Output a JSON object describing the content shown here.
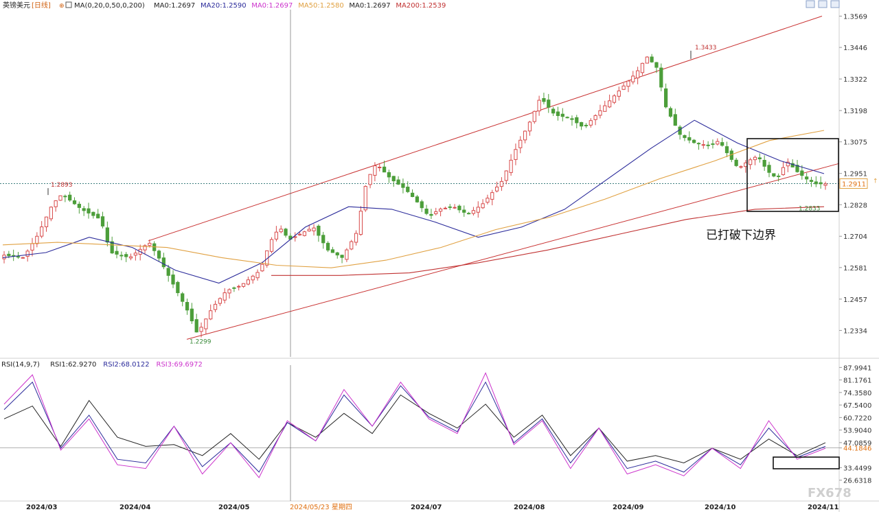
{
  "header": {
    "symbol": "英镑美元",
    "period": "日线",
    "ma_params": "MA(0,20,0,50,0,200)",
    "ma_values": [
      {
        "text": "MA0:1.2697",
        "color": "#222222"
      },
      {
        "text": "MA20:1.2590",
        "color": "#2a2a9a"
      },
      {
        "text": "MA0:1.2697",
        "color": "#cc33cc"
      },
      {
        "text": "MA50:1.2580",
        "color": "#e0a040"
      },
      {
        "text": "MA0:1.2697",
        "color": "#222222"
      },
      {
        "text": "MA200:1.2539",
        "color": "#c03030"
      }
    ]
  },
  "rsi_header": [
    {
      "text": "RSI(14,9,7)",
      "color": "#222222"
    },
    {
      "text": "RSI1:62.9270",
      "color": "#222222"
    },
    {
      "text": "RSI2:68.0122",
      "color": "#2a2a9a"
    },
    {
      "text": "RSI3:69.6972",
      "color": "#cc33cc"
    }
  ],
  "annotation": "已打破下边界",
  "crosshair_date": "2024/05/23 星期四",
  "watermark": "FX678",
  "colors": {
    "up": "#d84a4a",
    "down": "#4c9e3a",
    "ma20": "#2a2a9a",
    "ma50": "#e0a040",
    "ma200": "#c03030",
    "channel": "#c83030",
    "rsi1": "#222222",
    "rsi2": "#2a2a9a",
    "rsi3": "#cc33cc"
  },
  "chart_data": [
    {
      "type": "candlestick",
      "title": "英镑美元 日线",
      "x_labels": [
        "2024/03",
        "2024/04",
        "2024/05",
        "2024/05/23 星期四",
        "2024/07",
        "2024/08",
        "2024/09",
        "2024/10",
        "2024/11"
      ],
      "y_ticks": [
        "1.3569",
        "1.3446",
        "1.3322",
        "1.3198",
        "1.3075",
        "1.2951",
        "1.2828",
        "1.2704",
        "1.2581",
        "1.2457",
        "1.2334"
      ],
      "ylim": [
        1.223,
        1.36
      ],
      "n_bars": 176,
      "current_price": "1.2911",
      "labels": {
        "high1": "1.2893",
        "low": "1.2299",
        "high2": "1.3433",
        "recent_low": "1.2833"
      },
      "candles": [],
      "series": [
        {
          "name": "MA20",
          "values": [
            1.262,
            1.264,
            1.27,
            1.266,
            1.257,
            1.252,
            1.26,
            1.274,
            1.282,
            1.281,
            1.276,
            1.27,
            1.274,
            1.281,
            1.293,
            1.305,
            1.316,
            1.307,
            1.3,
            1.295
          ]
        },
        {
          "name": "MA50",
          "values": [
            1.267,
            1.268,
            1.267,
            1.266,
            1.262,
            1.259,
            1.258,
            1.261,
            1.266,
            1.273,
            1.278,
            1.285,
            1.293,
            1.3,
            1.308,
            1.312
          ]
        },
        {
          "name": "MA200",
          "values": [
            1.255,
            1.255,
            1.256,
            1.26,
            1.265,
            1.271,
            1.277,
            1.281,
            1.282
          ]
        }
      ]
    },
    {
      "type": "line",
      "title": "RSI(14,9,7)",
      "y_ticks": [
        "87.9941",
        "81.1761",
        "74.3580",
        "67.5400",
        "60.7220",
        "53.9040",
        "47.0859",
        "44.1846",
        "33.4499",
        "26.6318"
      ],
      "ylim": [
        22.0,
        90.0
      ],
      "series": [
        {
          "name": "RSI1",
          "values": [
            60,
            67,
            45,
            70,
            50,
            45,
            46,
            40,
            52,
            38,
            58,
            50,
            63,
            52,
            73,
            63,
            55,
            68,
            50,
            62,
            40,
            55,
            37,
            40,
            36,
            44,
            38,
            49,
            40,
            47
          ]
        },
        {
          "name": "RSI2",
          "values": [
            65,
            80,
            44,
            62,
            38,
            36,
            56,
            34,
            47,
            31,
            58,
            48,
            73,
            56,
            78,
            61,
            53,
            80,
            47,
            60,
            36,
            55,
            33,
            37,
            31,
            44,
            35,
            55,
            39,
            45
          ]
        },
        {
          "name": "RSI3",
          "values": [
            68,
            84,
            43,
            60,
            35,
            33,
            56,
            30,
            47,
            28,
            59,
            48,
            76,
            56,
            80,
            60,
            52,
            85,
            46,
            59,
            33,
            55,
            30,
            35,
            29,
            44,
            33,
            59,
            38,
            44
          ]
        }
      ]
    }
  ]
}
